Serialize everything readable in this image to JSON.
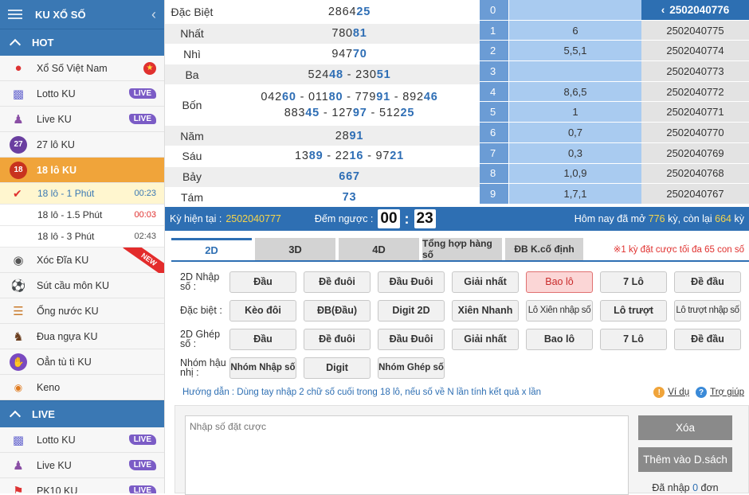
{
  "sidebar": {
    "title": "KU XỔ SỐ",
    "sections": {
      "hot": "HOT",
      "live": "LIVE"
    },
    "hot_items": [
      {
        "label": "Xổ Số Việt Nam",
        "badge": "star"
      },
      {
        "label": "Lotto KU",
        "badge": "LIVE"
      },
      {
        "label": "Live KU",
        "badge": "LIVE"
      },
      {
        "label": "27 lô KU",
        "icon_text": "27"
      },
      {
        "label": "18 lô KU",
        "icon_text": "18"
      }
    ],
    "sub_items": [
      {
        "label": "18 lô - 1 Phút",
        "time": "00:23"
      },
      {
        "label": "18 lô - 1.5 Phút",
        "time": "00:03"
      },
      {
        "label": "18 lô - 3 Phút",
        "time": "02:43"
      }
    ],
    "more_items": [
      {
        "label": "Xóc Đĩa KU",
        "ribbon": "NEW"
      },
      {
        "label": "Sút cầu môn KU"
      },
      {
        "label": "Ống nước KU"
      },
      {
        "label": "Đua ngựa KU"
      },
      {
        "label": "Oẳn tù tì KU"
      },
      {
        "label": "Keno"
      }
    ],
    "live_items": [
      {
        "label": "Lotto KU",
        "badge": "LIVE"
      },
      {
        "label": "Live KU",
        "badge": "LIVE"
      },
      {
        "label": "PK10 KU",
        "badge": "LIVE"
      }
    ]
  },
  "results": {
    "dacbiet": {
      "label": "Đặc Biệt",
      "a": "2864",
      "b": "25"
    },
    "nhat": {
      "label": "Nhất",
      "a": "780",
      "b": "81"
    },
    "nhi": {
      "label": "Nhì",
      "a": "947",
      "b": "70"
    },
    "ba": {
      "label": "Ba",
      "n1a": "524",
      "n1b": "48",
      "n2a": "230",
      "n2b": "51"
    },
    "bon": {
      "label": "Bốn",
      "r1": [
        [
          "042",
          "60"
        ],
        [
          "011",
          "80"
        ],
        [
          "779",
          "91"
        ],
        [
          "892",
          "46"
        ]
      ],
      "r2": [
        [
          "883",
          "45"
        ],
        [
          "127",
          "97"
        ],
        [
          "512",
          "25"
        ]
      ]
    },
    "nam": {
      "label": "Năm",
      "a": "28",
      "b": "91"
    },
    "sau": {
      "label": "Sáu",
      "r": [
        [
          "13",
          "89"
        ],
        [
          "22",
          "16"
        ],
        [
          "97",
          "21"
        ]
      ]
    },
    "bay": {
      "label": "Bảy",
      "v": "667"
    },
    "tam": {
      "label": "Tám",
      "v": "73"
    }
  },
  "loto": [
    {
      "k": "0",
      "v": ""
    },
    {
      "k": "1",
      "v": "6"
    },
    {
      "k": "2",
      "v": "5,5,1"
    },
    {
      "k": "3",
      "v": ""
    },
    {
      "k": "4",
      "v": "8,6,5"
    },
    {
      "k": "5",
      "v": "1"
    },
    {
      "k": "6",
      "v": "0,7"
    },
    {
      "k": "7",
      "v": "0,3"
    },
    {
      "k": "8",
      "v": "1,0,9"
    },
    {
      "k": "9",
      "v": "1,7,1"
    }
  ],
  "draws": {
    "current": "2502040776",
    "list": [
      "2502040775",
      "2502040774",
      "2502040773",
      "2502040772",
      "2502040771",
      "2502040770",
      "2502040769",
      "2502040768",
      "2502040767"
    ]
  },
  "status": {
    "ky_label": "Kỳ hiện tại :",
    "ky_value": "2502040777",
    "countdown_label": "Đếm ngược :",
    "min": "00",
    "sec": "23",
    "today_prefix": "Hôm nay đã mở",
    "opened": "776",
    "mid": "kỳ, còn lại",
    "remaining": "664",
    "suffix": "kỳ"
  },
  "tabs": [
    "2D",
    "3D",
    "4D",
    "Tổng hợp hàng số",
    "ĐB K.cố định"
  ],
  "tab_note": "※1 kỳ đặt cược tối đa 65 con số",
  "modes": [
    {
      "label": "2D Nhập số :",
      "buttons": [
        "Đầu",
        "Đề đuôi",
        "Đầu Đuôi",
        "Giải nhất",
        "Bao lô",
        "7 Lô",
        "Đề đầu"
      ]
    },
    {
      "label": "Đặc biệt :",
      "buttons": [
        "Kèo đôi",
        "ĐB(Đầu)",
        "Digit 2D",
        "Xiên Nhanh",
        "Lô Xiên nhập số",
        "Lô trượt",
        "Lô trượt nhập số"
      ]
    },
    {
      "label": "2D Ghép số :",
      "buttons": [
        "Đầu",
        "Đề đuôi",
        "Đầu Đuôi",
        "Giải nhất",
        "Bao lô",
        "7 Lô",
        "Đề đầu"
      ]
    },
    {
      "label": "Nhóm hậu nhị :",
      "buttons": [
        "Nhóm Nhập số",
        "Digit",
        "Nhóm Ghép số"
      ]
    }
  ],
  "guide": {
    "text": "Hướng dẫn : Dùng tay nhập 2 chữ số cuối trong 18 lô, nếu số về N lần tính kết quả x lần",
    "example": "Ví dụ",
    "help": "Trợ giúp"
  },
  "input": {
    "placeholder": "Nhập số đặt cược",
    "clear": "Xóa",
    "add": "Thêm vào D.sách",
    "entered_prefix": "Đã nhập",
    "entered_count": "0",
    "entered_suffix": "đơn"
  },
  "colors": {
    "primary": "#2e6fb3",
    "active": "#f0a43a",
    "highlight": "#f7d54a",
    "danger": "#e0312f"
  }
}
